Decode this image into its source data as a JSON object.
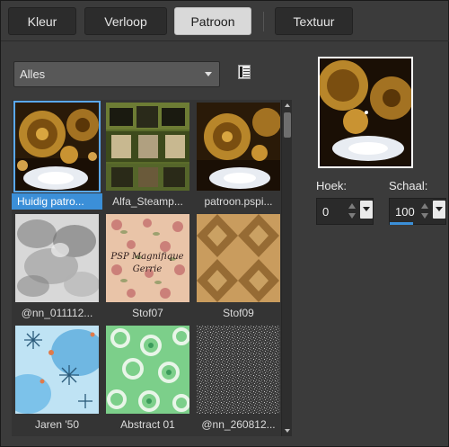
{
  "tabs": [
    {
      "label": "Kleur",
      "active": false
    },
    {
      "label": "Verloop",
      "active": false
    },
    {
      "label": "Patroon",
      "active": true
    },
    {
      "label": "Textuur",
      "active": false
    }
  ],
  "category_dropdown": {
    "value": "Alles"
  },
  "patterns": [
    {
      "label": "Huidig patro...",
      "selected": true
    },
    {
      "label": "Alfa_Steamp...",
      "selected": false
    },
    {
      "label": "patroon.pspi...",
      "selected": false
    },
    {
      "label": "@nn_011112...",
      "selected": false
    },
    {
      "label": "Stof07",
      "selected": false
    },
    {
      "label": "Stof09",
      "selected": false
    },
    {
      "label": "Jaren '50",
      "selected": false
    },
    {
      "label": "Abstract 01",
      "selected": false
    },
    {
      "label": "@nn_260812...",
      "selected": false
    }
  ],
  "stof07_overlay": {
    "line1": "PSP Magnifique",
    "line2": "Gerrie"
  },
  "angle": {
    "label": "Hoek:",
    "value": "0"
  },
  "scale": {
    "label": "Schaal:",
    "value": "100"
  },
  "colors": {
    "accent": "#3b8fd8",
    "background": "#3b3b3b"
  }
}
